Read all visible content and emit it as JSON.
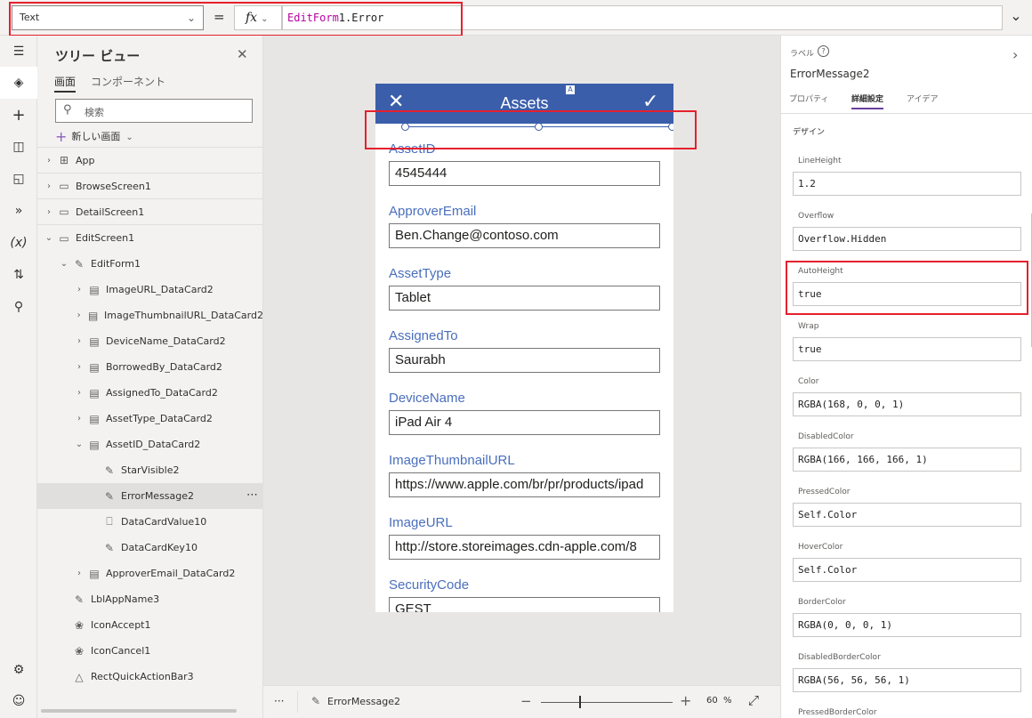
{
  "formula_bar": {
    "property": "Text",
    "equals": "=",
    "fx": "fx",
    "formula_keyword": "EditForm",
    "formula_rest": "1.Error"
  },
  "tree_view": {
    "title": "ツリー ビュー",
    "tabs": [
      "画面",
      "コンポーネント"
    ],
    "search_placeholder": "検索",
    "new_screen": "新しい画面",
    "items": [
      {
        "label": "App",
        "depth": 0,
        "icon": "app-icon",
        "chevron": "right",
        "top_level": true
      },
      {
        "label": "BrowseScreen1",
        "depth": 0,
        "icon": "screen-icon",
        "chevron": "right",
        "top_level": true
      },
      {
        "label": "DetailScreen1",
        "depth": 0,
        "icon": "screen-icon",
        "chevron": "right",
        "top_level": true
      },
      {
        "label": "EditScreen1",
        "depth": 0,
        "icon": "screen-icon",
        "chevron": "down",
        "top_level": false
      },
      {
        "label": "EditForm1",
        "depth": 1,
        "icon": "form-icon",
        "chevron": "down"
      },
      {
        "label": "ImageURL_DataCard2",
        "depth": 2,
        "icon": "card-icon",
        "chevron": "right"
      },
      {
        "label": "ImageThumbnailURL_DataCard2",
        "depth": 2,
        "icon": "card-icon",
        "chevron": "right"
      },
      {
        "label": "DeviceName_DataCard2",
        "depth": 2,
        "icon": "card-icon",
        "chevron": "right"
      },
      {
        "label": "BorrowedBy_DataCard2",
        "depth": 2,
        "icon": "card-icon",
        "chevron": "right"
      },
      {
        "label": "AssignedTo_DataCard2",
        "depth": 2,
        "icon": "card-icon",
        "chevron": "right"
      },
      {
        "label": "AssetType_DataCard2",
        "depth": 2,
        "icon": "card-icon",
        "chevron": "right"
      },
      {
        "label": "AssetID_DataCard2",
        "depth": 2,
        "icon": "card-icon",
        "chevron": "down"
      },
      {
        "label": "StarVisible2",
        "depth": 3,
        "icon": "label-icon",
        "chevron": "none"
      },
      {
        "label": "ErrorMessage2",
        "depth": 3,
        "icon": "label-icon",
        "chevron": "none",
        "selected": true
      },
      {
        "label": "DataCardValue10",
        "depth": 3,
        "icon": "textinput-icon",
        "chevron": "none"
      },
      {
        "label": "DataCardKey10",
        "depth": 3,
        "icon": "label-icon",
        "chevron": "none"
      },
      {
        "label": "ApproverEmail_DataCard2",
        "depth": 2,
        "icon": "card-icon",
        "chevron": "right"
      },
      {
        "label": "LblAppName3",
        "depth": 1,
        "icon": "label-icon",
        "chevron": "none"
      },
      {
        "label": "IconAccept1",
        "depth": 1,
        "icon": "icon-control-icon",
        "chevron": "none"
      },
      {
        "label": "IconCancel1",
        "depth": 1,
        "icon": "icon-control-icon",
        "chevron": "none"
      },
      {
        "label": "RectQuickActionBar3",
        "depth": 1,
        "icon": "shape-icon",
        "chevron": "none"
      }
    ]
  },
  "app_preview": {
    "title": "Assets",
    "handle_label": "A",
    "fields": [
      {
        "label": "AssetID",
        "value": "4545444"
      },
      {
        "label": "ApproverEmail",
        "value": "Ben.Change@contoso.com"
      },
      {
        "label": "AssetType",
        "value": "Tablet"
      },
      {
        "label": "AssignedTo",
        "value": "Saurabh"
      },
      {
        "label": "DeviceName",
        "value": "iPad Air 4"
      },
      {
        "label": "ImageThumbnailURL",
        "value": "https://www.apple.com/br/pr/products/ipad"
      },
      {
        "label": "ImageURL",
        "value": "http://store.storeimages.cdn-apple.com/8"
      },
      {
        "label": "SecurityCode",
        "value": "GEST"
      }
    ]
  },
  "status_bar": {
    "more": "···",
    "control_name": "ErrorMessage2",
    "zoom_minus": "−",
    "zoom_plus": "+",
    "zoom_value": "60",
    "zoom_unit": "%",
    "zoom_level": 0.3
  },
  "properties_panel": {
    "control_type": "ラベル",
    "help": "?",
    "control_name": "ErrorMessage2",
    "tabs": [
      "プロパティ",
      "詳細設定",
      "アイデア"
    ],
    "section": "デザイン",
    "properties": [
      {
        "name": "LineHeight",
        "value": "1.2"
      },
      {
        "name": "Overflow",
        "value": "Overflow.Hidden"
      },
      {
        "name": "AutoHeight",
        "value": "true"
      },
      {
        "name": "Wrap",
        "value": "true"
      },
      {
        "name": "Color",
        "value": "RGBA(168, 0, 0, 1)"
      },
      {
        "name": "DisabledColor",
        "value": "RGBA(166, 166, 166, 1)"
      },
      {
        "name": "PressedColor",
        "value": "Self.Color"
      },
      {
        "name": "HoverColor",
        "value": "Self.Color"
      },
      {
        "name": "BorderColor",
        "value": "RGBA(0, 0, 0, 1)"
      },
      {
        "name": "DisabledBorderColor",
        "value": "RGBA(56, 56, 56, 1)"
      },
      {
        "name": "PressedBorderColor",
        "value": ""
      }
    ]
  },
  "colors": {
    "header": "#3b5eab",
    "field_label": "#4a6fbd",
    "highlight": "#e5202e",
    "accent": "#6b3fa0"
  }
}
